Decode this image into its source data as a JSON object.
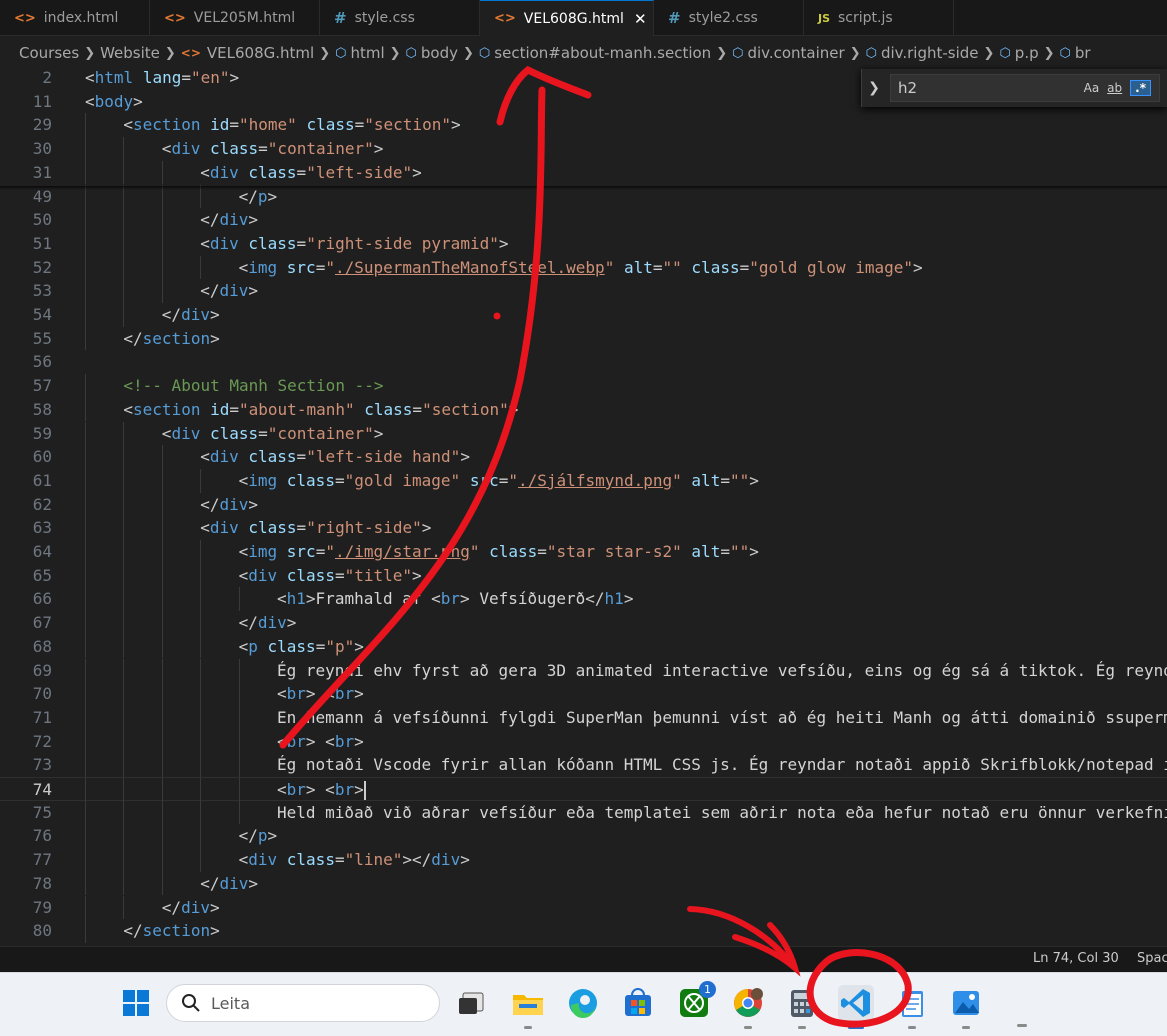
{
  "tabs": [
    {
      "label": "index.html",
      "icon": "html-file-icon",
      "active": false
    },
    {
      "label": "VEL205M.html",
      "icon": "html-file-icon",
      "active": false
    },
    {
      "label": "style.css",
      "icon": "css-file-icon",
      "active": false
    },
    {
      "label": "VEL608G.html",
      "icon": "html-file-icon",
      "active": true
    },
    {
      "label": "style2.css",
      "icon": "css-file-icon",
      "active": false
    },
    {
      "label": "script.js",
      "icon": "js-file-icon",
      "active": false
    }
  ],
  "breadcrumb": [
    "Courses",
    "Website",
    "VEL608G.html",
    "html",
    "body",
    "section#about-manh.section",
    "div.container",
    "div.right-side",
    "p.p",
    "br"
  ],
  "find": {
    "query": "h2",
    "match_case": "Aa",
    "whole_word": "ab",
    "regex": ".*"
  },
  "editor": {
    "current_line": "74",
    "lines": [
      {
        "n": "2",
        "indent": 0,
        "tokens": [
          [
            "t",
            "<"
          ],
          [
            "tag",
            "html"
          ],
          [
            "t",
            " "
          ],
          [
            "attr",
            "lang"
          ],
          [
            "t",
            "="
          ],
          [
            "str",
            "\"en\""
          ],
          [
            "t",
            ">"
          ]
        ]
      },
      {
        "n": "11",
        "indent": 0,
        "tokens": [
          [
            "t",
            "<"
          ],
          [
            "tag",
            "body"
          ],
          [
            "t",
            ">"
          ]
        ]
      },
      {
        "n": "29",
        "indent": 1,
        "tokens": [
          [
            "t",
            "<"
          ],
          [
            "tag",
            "section"
          ],
          [
            "t",
            " "
          ],
          [
            "attr",
            "id"
          ],
          [
            "t",
            "="
          ],
          [
            "str",
            "\"home\""
          ],
          [
            "t",
            " "
          ],
          [
            "attr",
            "class"
          ],
          [
            "t",
            "="
          ],
          [
            "str",
            "\"section\""
          ],
          [
            "t",
            ">"
          ]
        ]
      },
      {
        "n": "30",
        "indent": 2,
        "tokens": [
          [
            "t",
            "<"
          ],
          [
            "tag",
            "div"
          ],
          [
            "t",
            " "
          ],
          [
            "attr",
            "class"
          ],
          [
            "t",
            "="
          ],
          [
            "str",
            "\"container\""
          ],
          [
            "t",
            ">"
          ]
        ]
      },
      {
        "n": "31",
        "indent": 3,
        "tokens": [
          [
            "t",
            "<"
          ],
          [
            "tag",
            "div"
          ],
          [
            "t",
            " "
          ],
          [
            "attr",
            "class"
          ],
          [
            "t",
            "="
          ],
          [
            "str",
            "\"left-side\""
          ],
          [
            "t",
            ">"
          ]
        ]
      },
      {
        "n": "49",
        "indent": 4,
        "tokens": [
          [
            "t",
            "</"
          ],
          [
            "tag",
            "p"
          ],
          [
            "t",
            ">"
          ]
        ]
      },
      {
        "n": "50",
        "indent": 3,
        "tokens": [
          [
            "t",
            "</"
          ],
          [
            "tag",
            "div"
          ],
          [
            "t",
            ">"
          ]
        ]
      },
      {
        "n": "51",
        "indent": 3,
        "tokens": [
          [
            "t",
            "<"
          ],
          [
            "tag",
            "div"
          ],
          [
            "t",
            " "
          ],
          [
            "attr",
            "class"
          ],
          [
            "t",
            "="
          ],
          [
            "str",
            "\"right-side pyramid\""
          ],
          [
            "t",
            ">"
          ]
        ]
      },
      {
        "n": "52",
        "indent": 4,
        "tokens": [
          [
            "t",
            "<"
          ],
          [
            "tag",
            "img"
          ],
          [
            "t",
            " "
          ],
          [
            "attr",
            "src"
          ],
          [
            "t",
            "="
          ],
          [
            "str",
            "\""
          ],
          [
            "link",
            "./SupermanTheManofSteel.webp"
          ],
          [
            "str",
            "\""
          ],
          [
            "t",
            " "
          ],
          [
            "attr",
            "alt"
          ],
          [
            "t",
            "="
          ],
          [
            "str",
            "\"\""
          ],
          [
            "t",
            " "
          ],
          [
            "attr",
            "class"
          ],
          [
            "t",
            "="
          ],
          [
            "str",
            "\"gold glow image\""
          ],
          [
            "t",
            ">"
          ]
        ]
      },
      {
        "n": "53",
        "indent": 3,
        "tokens": [
          [
            "t",
            "</"
          ],
          [
            "tag",
            "div"
          ],
          [
            "t",
            ">"
          ]
        ]
      },
      {
        "n": "54",
        "indent": 2,
        "tokens": [
          [
            "t",
            "</"
          ],
          [
            "tag",
            "div"
          ],
          [
            "t",
            ">"
          ]
        ]
      },
      {
        "n": "55",
        "indent": 1,
        "tokens": [
          [
            "t",
            "</"
          ],
          [
            "tag",
            "section"
          ],
          [
            "t",
            ">"
          ]
        ]
      },
      {
        "n": "56",
        "indent": 0,
        "tokens": []
      },
      {
        "n": "57",
        "indent": 1,
        "tokens": [
          [
            "com",
            "<!-- About Manh Section -->"
          ]
        ]
      },
      {
        "n": "58",
        "indent": 1,
        "tokens": [
          [
            "t",
            "<"
          ],
          [
            "tag",
            "section"
          ],
          [
            "t",
            " "
          ],
          [
            "attr",
            "id"
          ],
          [
            "t",
            "="
          ],
          [
            "str",
            "\"about-manh\""
          ],
          [
            "t",
            " "
          ],
          [
            "attr",
            "class"
          ],
          [
            "t",
            "="
          ],
          [
            "str",
            "\"section\""
          ],
          [
            "t",
            ">"
          ]
        ]
      },
      {
        "n": "59",
        "indent": 2,
        "tokens": [
          [
            "t",
            "<"
          ],
          [
            "tag",
            "div"
          ],
          [
            "t",
            " "
          ],
          [
            "attr",
            "class"
          ],
          [
            "t",
            "="
          ],
          [
            "str",
            "\"container\""
          ],
          [
            "t",
            ">"
          ]
        ]
      },
      {
        "n": "60",
        "indent": 3,
        "tokens": [
          [
            "t",
            "<"
          ],
          [
            "tag",
            "div"
          ],
          [
            "t",
            " "
          ],
          [
            "attr",
            "class"
          ],
          [
            "t",
            "="
          ],
          [
            "str",
            "\"left-side hand\""
          ],
          [
            "t",
            ">"
          ]
        ]
      },
      {
        "n": "61",
        "indent": 4,
        "tokens": [
          [
            "t",
            "<"
          ],
          [
            "tag",
            "img"
          ],
          [
            "t",
            " "
          ],
          [
            "attr",
            "class"
          ],
          [
            "t",
            "="
          ],
          [
            "str",
            "\"gold image\""
          ],
          [
            "t",
            " "
          ],
          [
            "attr",
            "src"
          ],
          [
            "t",
            "="
          ],
          [
            "str",
            "\""
          ],
          [
            "link",
            "./Sjálfsmynd.png"
          ],
          [
            "str",
            "\""
          ],
          [
            "t",
            " "
          ],
          [
            "attr",
            "alt"
          ],
          [
            "t",
            "="
          ],
          [
            "str",
            "\"\""
          ],
          [
            "t",
            ">"
          ]
        ]
      },
      {
        "n": "62",
        "indent": 3,
        "tokens": [
          [
            "t",
            "</"
          ],
          [
            "tag",
            "div"
          ],
          [
            "t",
            ">"
          ]
        ]
      },
      {
        "n": "63",
        "indent": 3,
        "tokens": [
          [
            "t",
            "<"
          ],
          [
            "tag",
            "div"
          ],
          [
            "t",
            " "
          ],
          [
            "attr",
            "class"
          ],
          [
            "t",
            "="
          ],
          [
            "str",
            "\"right-side\""
          ],
          [
            "t",
            ">"
          ]
        ]
      },
      {
        "n": "64",
        "indent": 4,
        "tokens": [
          [
            "t",
            "<"
          ],
          [
            "tag",
            "img"
          ],
          [
            "t",
            " "
          ],
          [
            "attr",
            "src"
          ],
          [
            "t",
            "="
          ],
          [
            "str",
            "\""
          ],
          [
            "link",
            "./img/star.png"
          ],
          [
            "str",
            "\""
          ],
          [
            "t",
            " "
          ],
          [
            "attr",
            "class"
          ],
          [
            "t",
            "="
          ],
          [
            "str",
            "\"star star-s2\""
          ],
          [
            "t",
            " "
          ],
          [
            "attr",
            "alt"
          ],
          [
            "t",
            "="
          ],
          [
            "str",
            "\"\""
          ],
          [
            "t",
            ">"
          ]
        ]
      },
      {
        "n": "65",
        "indent": 4,
        "tokens": [
          [
            "t",
            "<"
          ],
          [
            "tag",
            "div"
          ],
          [
            "t",
            " "
          ],
          [
            "attr",
            "class"
          ],
          [
            "t",
            "="
          ],
          [
            "str",
            "\"title\""
          ],
          [
            "t",
            ">"
          ]
        ]
      },
      {
        "n": "66",
        "indent": 5,
        "tokens": [
          [
            "t",
            "<"
          ],
          [
            "tag",
            "h1"
          ],
          [
            "t",
            ">"
          ],
          [
            "txt",
            "Framhald af "
          ],
          [
            "t",
            "<"
          ],
          [
            "tag",
            "br"
          ],
          [
            "t",
            ">"
          ],
          [
            "txt",
            " Vefsíðugerð"
          ],
          [
            "t",
            "</"
          ],
          [
            "tag",
            "h1"
          ],
          [
            "t",
            ">"
          ]
        ]
      },
      {
        "n": "67",
        "indent": 4,
        "tokens": [
          [
            "t",
            "</"
          ],
          [
            "tag",
            "div"
          ],
          [
            "t",
            ">"
          ]
        ]
      },
      {
        "n": "68",
        "indent": 4,
        "tokens": [
          [
            "t",
            "<"
          ],
          [
            "tag",
            "p"
          ],
          [
            "t",
            " "
          ],
          [
            "attr",
            "class"
          ],
          [
            "t",
            "="
          ],
          [
            "str",
            "\"p\""
          ],
          [
            "t",
            ">"
          ]
        ]
      },
      {
        "n": "69",
        "indent": 5,
        "tokens": [
          [
            "txt",
            "Ég reyndi ehv fyrst að gera 3D animated interactive vefsíðu, eins og ég sá á tiktok. Ég reynd"
          ]
        ]
      },
      {
        "n": "70",
        "indent": 5,
        "tokens": [
          [
            "t",
            "<"
          ],
          [
            "tag",
            "br"
          ],
          [
            "t",
            "> <"
          ],
          [
            "tag",
            "br"
          ],
          [
            "t",
            ">"
          ]
        ]
      },
      {
        "n": "71",
        "indent": 5,
        "tokens": [
          [
            "txt",
            "En hemann á vefsíðunni fylgdi SuperMan þemunni víst að ég heiti Manh og átti domainið ssuperm"
          ]
        ]
      },
      {
        "n": "72",
        "indent": 5,
        "tokens": [
          [
            "t",
            "<"
          ],
          [
            "tag",
            "br"
          ],
          [
            "t",
            "> <"
          ],
          [
            "tag",
            "br"
          ],
          [
            "t",
            ">"
          ]
        ]
      },
      {
        "n": "73",
        "indent": 5,
        "tokens": [
          [
            "txt",
            "Ég notaði Vscode fyrir allan kóðann HTML CSS js. Ég reyndar notaði appið Skrifblokk/notepad i"
          ]
        ]
      },
      {
        "n": "74",
        "indent": 5,
        "tokens": [
          [
            "t",
            "<"
          ],
          [
            "tag",
            "br"
          ],
          [
            "t",
            "> <"
          ],
          [
            "tag",
            "br"
          ],
          [
            "t",
            ">"
          ]
        ]
      },
      {
        "n": "75",
        "indent": 5,
        "tokens": [
          [
            "txt",
            "Held miðað við aðrar vefsíður eða templatei sem aðrir nota eða hefur notað eru önnur verkefni"
          ]
        ]
      },
      {
        "n": "76",
        "indent": 4,
        "tokens": [
          [
            "t",
            "</"
          ],
          [
            "tag",
            "p"
          ],
          [
            "t",
            ">"
          ]
        ]
      },
      {
        "n": "77",
        "indent": 4,
        "tokens": [
          [
            "t",
            "<"
          ],
          [
            "tag",
            "div"
          ],
          [
            "t",
            " "
          ],
          [
            "attr",
            "class"
          ],
          [
            "t",
            "="
          ],
          [
            "str",
            "\"line\""
          ],
          [
            "t",
            "></"
          ],
          [
            "tag",
            "div"
          ],
          [
            "t",
            ">"
          ]
        ]
      },
      {
        "n": "78",
        "indent": 3,
        "tokens": [
          [
            "t",
            "</"
          ],
          [
            "tag",
            "div"
          ],
          [
            "t",
            ">"
          ]
        ]
      },
      {
        "n": "79",
        "indent": 2,
        "tokens": [
          [
            "t",
            "</"
          ],
          [
            "tag",
            "div"
          ],
          [
            "t",
            ">"
          ]
        ]
      },
      {
        "n": "80",
        "indent": 1,
        "tokens": [
          [
            "t",
            "</"
          ],
          [
            "tag",
            "section"
          ],
          [
            "t",
            ">"
          ]
        ]
      }
    ]
  },
  "status": {
    "position": "Ln 74, Col 30",
    "spaces": "Spac"
  },
  "taskbar": {
    "search_label": "Leita",
    "xbox_badge": "1",
    "apps": [
      "start-icon",
      "task-view-icon",
      "file-explorer-icon",
      "edge-icon",
      "store-icon",
      "xbox-icon",
      "chrome-icon",
      "calculator-icon",
      "vscode-icon",
      "notepad-icon",
      "photos-icon"
    ]
  },
  "colors": {
    "accent": "#0078d4",
    "annotation": "#e8141e"
  }
}
